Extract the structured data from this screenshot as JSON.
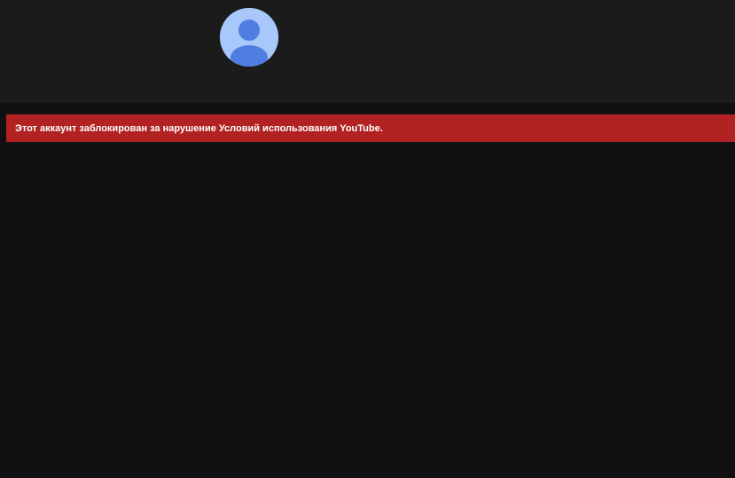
{
  "channel": {
    "avatar_icon": "default-user-avatar-icon",
    "avatar_bg": "#a8c7fa",
    "avatar_fg": "#4e7ee0"
  },
  "alert": {
    "message": "Этот аккаунт заблокирован за нарушение Условий использования YouTube.",
    "color": "#b22222",
    "text_color": "#ffffff"
  },
  "colors": {
    "page_bg": "#111111",
    "header_bg": "#1b1b1b"
  }
}
